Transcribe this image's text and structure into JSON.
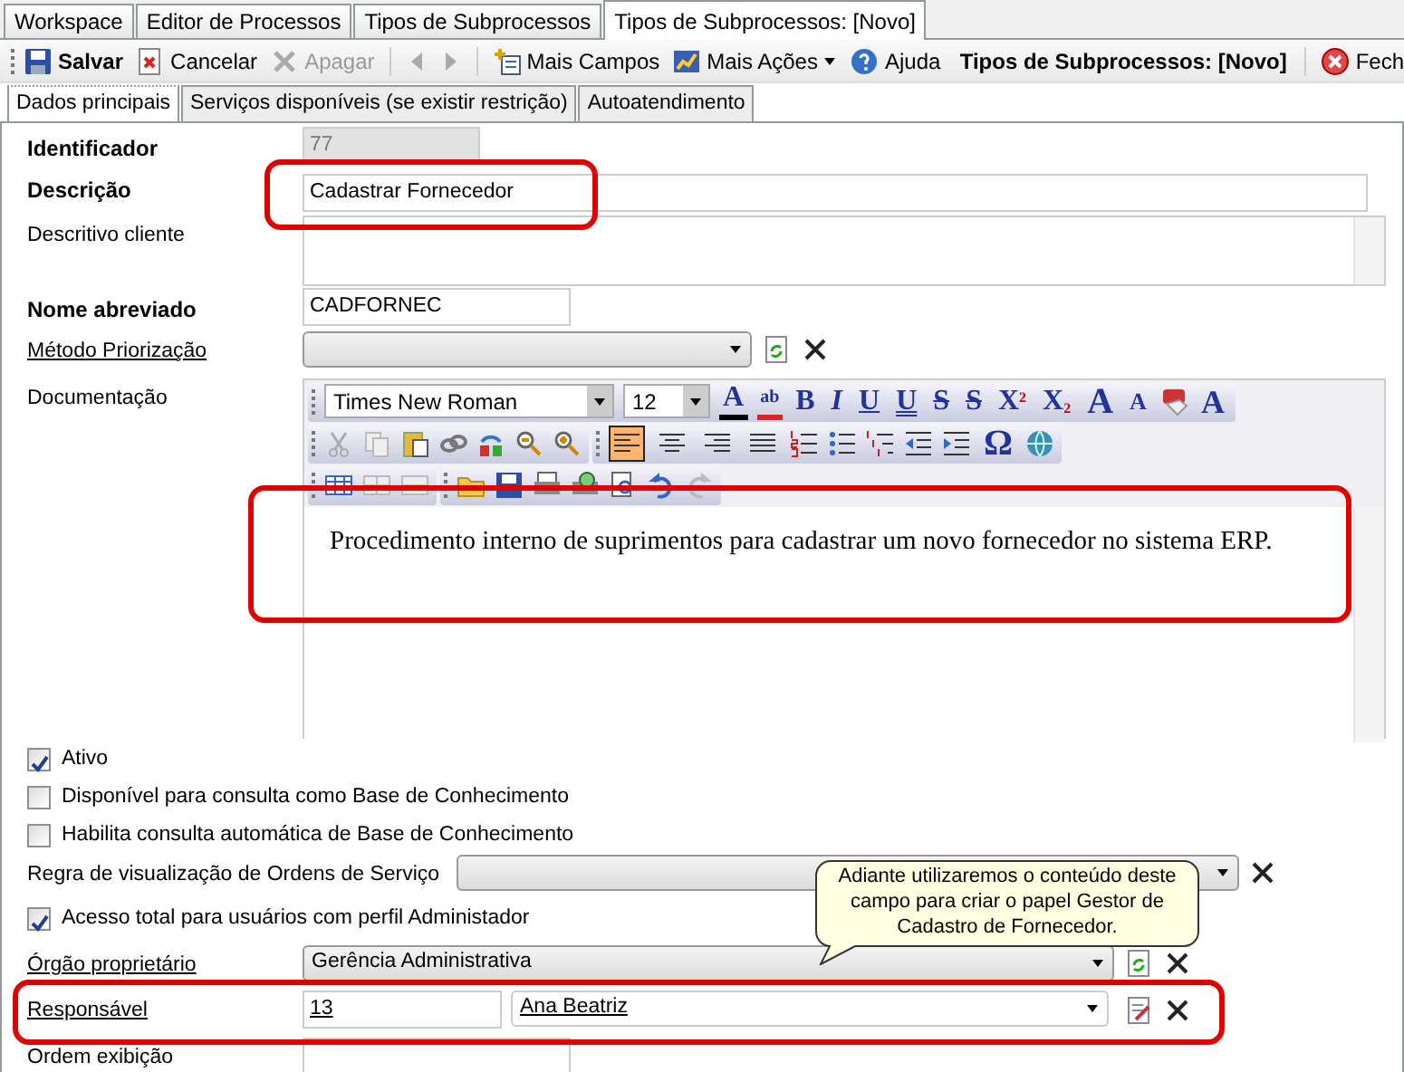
{
  "tabs": [
    {
      "label": "Workspace",
      "selected": false
    },
    {
      "label": "Editor de Processos",
      "selected": false
    },
    {
      "label": "Tipos de Subprocessos",
      "selected": false
    },
    {
      "label": "Tipos de Subprocessos: [Novo]",
      "selected": true
    }
  ],
  "toolbar": {
    "items": [
      {
        "kind": "save",
        "label": "Salvar",
        "bold": true,
        "disabled": false
      },
      {
        "kind": "cancel",
        "label": "Cancelar",
        "bold": false,
        "disabled": false
      },
      {
        "kind": "delete",
        "label": "Apagar",
        "bold": false,
        "disabled": true
      },
      {
        "kind": "prev",
        "disabled": true
      },
      {
        "kind": "next",
        "disabled": true
      },
      {
        "kind": "fields",
        "label": "Mais Campos",
        "bold": false,
        "disabled": false
      },
      {
        "kind": "actions",
        "label": "Mais Ações",
        "bold": false,
        "disabled": false
      },
      {
        "kind": "help",
        "label": "Ajuda",
        "bold": false,
        "disabled": false
      }
    ],
    "context_title": "Tipos de Subprocessos: [Novo]",
    "close_label": "Fech"
  },
  "subtabs": [
    {
      "label": "Dados principais",
      "selected": true
    },
    {
      "label": "Serviços disponíveis (se existir restrição)",
      "selected": false
    },
    {
      "label": "Autoatendimento",
      "selected": false
    }
  ],
  "fields": [
    {
      "kind": "text",
      "label": "Identificador",
      "bold": true,
      "underlined": false,
      "value": "77",
      "disabled": true
    },
    {
      "kind": "text",
      "label": "Descrição",
      "bold": true,
      "underlined": false,
      "value": "Cadastrar Fornecedor",
      "disabled": false
    },
    {
      "kind": "textarea",
      "label": "Descritivo cliente",
      "bold": false,
      "underlined": false
    },
    {
      "kind": "text",
      "label": "Nome abreviado",
      "bold": true,
      "underlined": false,
      "value": "CADFORNEC",
      "disabled": false
    },
    {
      "kind": "select",
      "label": "Método Priorização",
      "bold": false,
      "underlined": true,
      "refresh": true
    },
    {
      "kind": "editor",
      "label": "Documentação",
      "bold": false,
      "underlined": false
    },
    {
      "kind": "checkbox",
      "label": "Ativo",
      "checked": true
    },
    {
      "kind": "checkbox",
      "label": "Disponível para consulta como Base de Conhecimento",
      "checked": false
    },
    {
      "kind": "checkbox",
      "label": "Habilita consulta automática de Base de Conhecimento",
      "checked": false
    },
    {
      "kind": "select",
      "label": "Regra de visualização de Ordens de Serviço",
      "bold": false,
      "underlined": false,
      "refresh": false
    },
    {
      "kind": "checkbox",
      "label": "Acesso total para usuários com perfil Administador",
      "checked": true
    },
    {
      "kind": "select",
      "label": "Órgão proprietário",
      "bold": false,
      "underlined": true,
      "value": "Gerência Administrativa",
      "refresh": true
    },
    {
      "kind": "lookup",
      "label": "Responsável",
      "bold": false,
      "underlined": true,
      "code": "13",
      "value": "Ana Beatriz"
    },
    {
      "kind": "text",
      "label": "Ordem exibição",
      "disabled": false
    }
  ],
  "editor": {
    "font": "Times New Roman",
    "size": "12",
    "format_glyphs": [
      "A",
      "ab",
      "B",
      "I",
      "U",
      "U",
      "S",
      "S",
      "X$^{2}$",
      "X$_{2}$",
      "A",
      "A",
      "A"
    ],
    "alignments": [
      {
        "selected": true
      },
      {
        "selected": false
      },
      {
        "selected": false
      },
      {
        "selected": false
      }
    ],
    "symbol_glyph": "Ω",
    "content": "Procedimento interno de suprimentos para cadastrar um novo fornecedor no sistema ERP."
  },
  "callout": "Adiante utilizaremos o conteúdo deste campo para criar o papel Gestor de Cadastro de Fornecedor."
}
